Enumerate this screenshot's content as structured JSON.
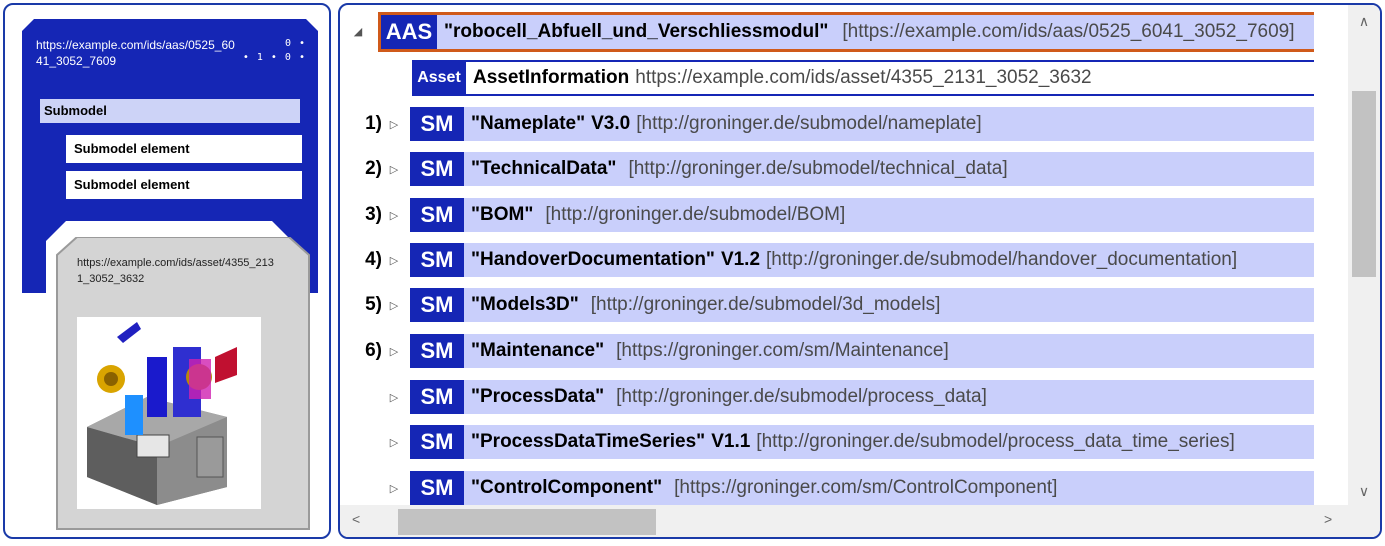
{
  "left_panel": {
    "aas_id": "https://example.com/ids/aas/0525_6041_3052_7609",
    "id_glyph_line1": "0 •",
    "id_glyph_line2": "• 1 • 0 •",
    "submodel_label": "Submodel",
    "element_labels": [
      "Submodel element",
      "Submodel element"
    ],
    "asset_id": "https://example.com/ids/asset/4355_2131_3052_3632",
    "colors": {
      "aas_fill": "#1526b5",
      "asset_fill": "#d4d4d4",
      "submodel_fill": "#cdd3f7"
    }
  },
  "tree": {
    "aas": {
      "badge": "AAS",
      "idshort": "\"robocell_Abfuell_und_Verschliessmodul\"",
      "id": "[https://example.com/ids/aas/0525_6041_3052_7609]",
      "toggle": "◢"
    },
    "asset": {
      "badge": "Asset",
      "label": "AssetInformation",
      "id": "https://example.com/ids/asset/4355_2131_3052_3632"
    },
    "submodels": [
      {
        "num": "1)",
        "badge": "SM",
        "idshort": "\"Nameplate\"",
        "version": "V3.0",
        "semantic_id": "[http://groninger.de/submodel/nameplate]"
      },
      {
        "num": "2)",
        "badge": "SM",
        "idshort": "\"TechnicalData\"",
        "version": "",
        "semantic_id": "[http://groninger.de/submodel/technical_data]"
      },
      {
        "num": "3)",
        "badge": "SM",
        "idshort": "\"BOM\"",
        "version": "",
        "semantic_id": "[http://groninger.de/submodel/BOM]"
      },
      {
        "num": "4)",
        "badge": "SM",
        "idshort": "\"HandoverDocumentation\"",
        "version": "V1.2",
        "semantic_id": "[http://groninger.de/submodel/handover_documentation]"
      },
      {
        "num": "5)",
        "badge": "SM",
        "idshort": "\"Models3D\"",
        "version": "",
        "semantic_id": "[http://groninger.de/submodel/3d_models]"
      },
      {
        "num": "6)",
        "badge": "SM",
        "idshort": "\"Maintenance\"",
        "version": "",
        "semantic_id": "[https://groninger.com/sm/Maintenance]"
      },
      {
        "num": "",
        "badge": "SM",
        "idshort": "\"ProcessData\"",
        "version": "",
        "semantic_id": "[http://groninger.de/submodel/process_data]"
      },
      {
        "num": "",
        "badge": "SM",
        "idshort": "\"ProcessDataTimeSeries\"",
        "version": "V1.1",
        "semantic_id": "[http://groninger.de/submodel/process_data_time_series]"
      },
      {
        "num": "",
        "badge": "SM",
        "idshort": "\"ControlComponent\"",
        "version": "",
        "semantic_id": "[https://groninger.com/sm/ControlComponent]"
      }
    ],
    "collapsed_toggle": "▷",
    "scroll_up": "∧",
    "scroll_down": "∨",
    "scroll_left": "<",
    "scroll_right": ">",
    "colors": {
      "badge": "#1526b5",
      "row": "#c9cffb",
      "aas_border": "#d05a1a"
    }
  }
}
